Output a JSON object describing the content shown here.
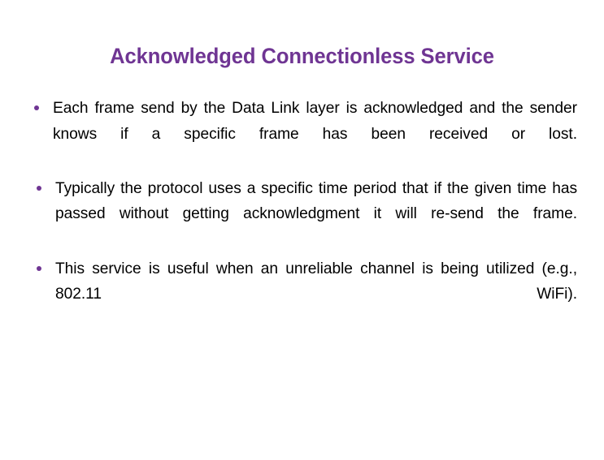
{
  "slide": {
    "background_color": "#ffffff",
    "title": "Acknowledged Connectionless Service",
    "title_color": "#6f3593",
    "body_text_color": "#000000",
    "bullet_marker_color": "#6f3593",
    "bullets": [
      {
        "marker": "round-bullet",
        "text": "Each frame send by the Data Link layer is acknowledged and the sender knows if a specific frame has been received or lost."
      },
      {
        "marker": "round-bullet",
        "text": "Typically the protocol uses a specific time period that if the given time has passed without getting acknowledgment it will re-send the frame."
      },
      {
        "marker": "round-bullet",
        "text": "This service is useful when an unreliable channel is being utilized (e.g., 802.11 WiFi)."
      }
    ]
  }
}
